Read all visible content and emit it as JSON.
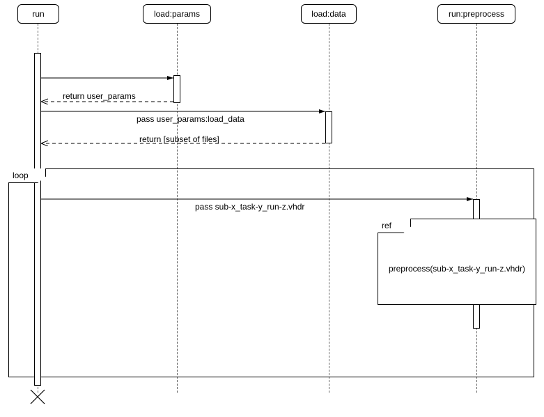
{
  "participants": {
    "run": "run",
    "load_params": "load:params",
    "load_data": "load:data",
    "run_preprocess": "run:preprocess"
  },
  "messages": {
    "ret_user_params": "return user_params",
    "pass_load_data": "pass user_params:load_data",
    "ret_subset": "return [subset of files]",
    "pass_vhdr": "pass sub-x_task-y_run-z.vhdr"
  },
  "fragments": {
    "loop_label": "loop",
    "ref_label": "ref",
    "ref_text": "preprocess(sub-x_task-y_run-z.vhdr)"
  },
  "chart_data": {
    "type": "sequence-diagram",
    "participants": [
      "run",
      "load:params",
      "load:data",
      "run:preprocess"
    ],
    "interactions": [
      {
        "from": "run",
        "to": "load:params",
        "type": "sync",
        "label": ""
      },
      {
        "from": "load:params",
        "to": "run",
        "type": "return",
        "label": "return user_params"
      },
      {
        "from": "run",
        "to": "load:data",
        "type": "sync",
        "label": "pass user_params:load_data"
      },
      {
        "from": "load:data",
        "to": "run",
        "type": "return",
        "label": "return [subset of files]"
      },
      {
        "fragment": "loop",
        "contains": [
          {
            "from": "run",
            "to": "run:preprocess",
            "type": "sync",
            "label": "pass sub-x_task-y_run-z.vhdr"
          },
          {
            "fragment": "ref",
            "text": "preprocess(sub-x_task-y_run-z.vhdr)"
          }
        ]
      }
    ],
    "terminated": [
      "run"
    ]
  }
}
